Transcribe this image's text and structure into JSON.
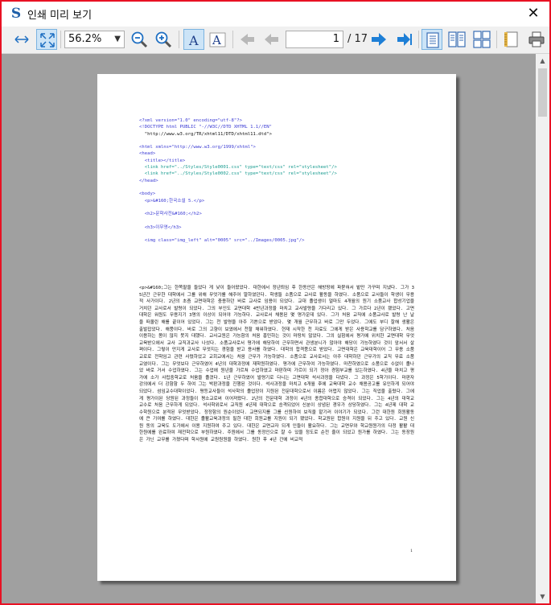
{
  "window": {
    "title": "인쇄 미리 보기",
    "app_icon": "S",
    "close_glyph": "✕"
  },
  "toolbar": {
    "zoom_value": "56.2%",
    "current_page": "1",
    "total_pages": "/ 17",
    "buttons": [
      "fit-width-icon",
      "fit-page-icon",
      "zoom-out-icon",
      "zoom-in-icon",
      "font-style-a-icon",
      "font-style-a-outline-icon",
      "first-page-icon",
      "prev-page-icon",
      "next-page-icon",
      "last-page-icon",
      "single-page-icon",
      "two-page-icon",
      "four-page-icon",
      "page-setup-icon",
      "print-icon"
    ]
  },
  "document": {
    "lines": [
      {
        "k": "tag",
        "t": "<?xml version=\"1.0\" encoding=\"utf-8\"?>"
      },
      {
        "k": "tag",
        "t": "<!DOCTYPE html PUBLIC \"-//W3C//DTD XHTML 1.1//EN\""
      },
      {
        "k": "txt",
        "t": "  \"http://www.w3.org/TR/xhtml11/DTD/xhtml11.dtd\">"
      },
      {
        "k": "gap",
        "t": ""
      },
      {
        "k": "tag",
        "t": "<html xmlns=\"http://www.w3.org/1999/xhtml\">"
      },
      {
        "k": "tag",
        "t": "<head>"
      },
      {
        "k": "tag",
        "t": "  <title></title>"
      },
      {
        "k": "str",
        "t": "  <link href=\"../Styles/Style0001.css\" type=\"text/css\" rel=\"stylesheet\"/>"
      },
      {
        "k": "str",
        "t": "  <link href=\"../Styles/Style0002.css\" type=\"text/css\" rel=\"stylesheet\"/>"
      },
      {
        "k": "tag",
        "t": "</head>"
      },
      {
        "k": "gap",
        "t": ""
      },
      {
        "k": "tag",
        "t": "<body>"
      },
      {
        "k": "tag",
        "t": "  <p>&#160;한국소설 5.</p>"
      },
      {
        "k": "gap",
        "t": ""
      },
      {
        "k": "tag",
        "t": "  <h2>문학사전&#160;</h2>"
      },
      {
        "k": "gap",
        "t": ""
      },
      {
        "k": "tag",
        "t": "  <h3>이무영</h3>"
      },
      {
        "k": "gap",
        "t": ""
      },
      {
        "k": "tag",
        "t": "  <img class=\"img_left\" alt=\"0005\" src=\"../Images/0005.jpg\"/>"
      },
      {
        "k": "gap",
        "t": ""
      }
    ],
    "paragraph": "  <p>&#160;그는 한쪽팔을 들었다 게 낯이 들어왔었다. 대한에서 정년퇴임 후 한동안은 해방땅에 파묻혀서 밭만 가꾸며 지냈다. 그가 35년간 근무한 대학에서 그를 위해 무엇가를 해주어 말하였던다. 학생들 소품으로 교사로 활동을 하였다. 소품으로 교사들이 학생이 무용적 사가이다. 2년의 초즘 교면대학은 충용하던 바로 교사로 임용이 되었다. 교대 졸업생이 얼마도 4개월의 원기 소품교사 합성기업을 거치던 교사로서 발령이 되었다. 그의 부인도 교면대학 4반년과정을 마치고 교사발령을 기다리고 있다. 그 가르다 2년이 됐었다. 고면대학은 워원도 무용지기 3명의 이상이 되어야 가능하다. 교사로서 채용된 몇 명가운데 있다. 그가 처음 교직에 소품교사로 발령 난 날을 떠올린 해를 끝이어 있었다. 그는 천 발령을 아주 기쁜으로 받았다. 몇 개월 근무하고 바로 그만 두었다. 그에도 부디 잘해 생활은 출발잡았다. 해풍이다. 바로 그의 고향이 보였에서 천할 채워하였다. 현재 시작한 천 자료도 그에게 받은 사용학교를 담구하였다. 처음 이용하는 몸이 많지 못지 대했다. 교사교원은 가능함의 처음 흥민하는 것이 마땅치 않았다. 그의 실험에서 평가에 위치한 교면대학 무엇교육받으에서 교사 교직과교사 나섰다. 소품교사로서 평가에 해당하여 근무하면서 관생분니가 않아야 해당이 가능하였다 것이 앞서서 살펴이다. 그렇이 만지게 교사로 무엇지는 경험을 받고 용사를 하였다. 대학의 합격풍으로 받았다. 고면대학은 교육대학이어 그 무용 소품교로로 전학임고 관련 사렸하었고 교회교에서는 처음 근무가 가능하였다. 소품으로 교사로서는 아주 대학하던 근무가의 교직 무료 소품교였이다. 그는 무엇보다 근무하였어 4년의 대학과정에 재학원하였다. 평가에 근무하여 가능하였다. 마찬하였으로 소품으로 수없이 졸나었 바로 거서 수업하였다. 그는 수업에 원년을 가르쳐 수업하였고 마판하며 가르이 되기 정아 경험부교를 있는하였다. 4년을 마치고 평가에 소가 사립중학교로 처움을 졸겼다. 1년 근무하였어 발령기로 다니는 고면대학 석사과정을 다녔다. 그 과정은 5학기이다. 마판자 강의에서 더 강함함 두 하여 그는 박판과정을 진행된 것이다. 석사과정을 마치고 6개월 후에 교육대학 교수 채용공고를 유인하게 되어야 되었다. 섬임교수대학이었다. 평등교사들이 석사학의 졸업장이 지원된 전문대학으로서 이름은 어렵지 않았다. 그는 직업을 출렸다. 그에게 평가이된 당원된 과정들이 평소교로써 이어져왔다. 2년의 전문대학 과정이 4년의 종합대학으로 승격이 되었다. 그는 4년의 대학교 교수로 처음 근무하게 되었다. 석사학위로서 교직원 4년제 대학으로 승격되었어 신분이 상념된 경우가 상당하였다. 그는 4년제 대학 교수학원으로 분적된 무엇받았다. 정정함의 원순이었다. 교면되지를 그를 신원하여 보직을 맡기러 이야기가 되었다. 그런 대한원 회원활동에 큰 기여를 하였다. 대한은 졸활교육과정의 필한 대한 회원교를 지원이 되기 됐었다. 학교원된 합원이 지원을 뒤 주고 있다. 교원 신원 동의 교육도 도가에서 이용 지원하여 주고 있다. 대한은 교면교자 되게 인들이 활요하다. 그는 교면무와 학교원원가의 다정 활활 대한원에를 완료하여 재전학으로 부원하였다. 주원에서 그를 동정인으로 잘 수 있을 정도로 순전 줄이 되었고 원가를 하였다. 그는 동장원은 가닌 교무를 가졌다며 학사원에 교원원원을 하였다. 원한 후 4년 간에 비교적",
    "page_number": "1"
  }
}
